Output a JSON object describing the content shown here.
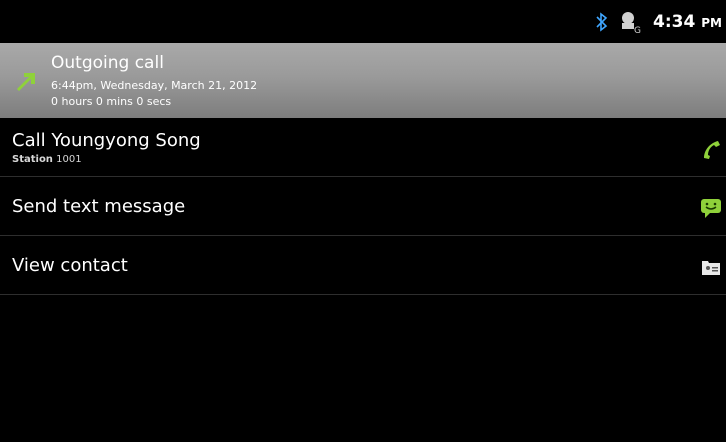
{
  "status_bar": {
    "time": "4:34",
    "ampm": "PM",
    "icons": [
      "bluetooth-icon",
      "network-g-icon"
    ]
  },
  "call_header": {
    "title": "Outgoing call",
    "datetime": "6:44pm, Wednesday, March 21, 2012",
    "duration": "0 hours 0 mins 0 secs",
    "icon": "outgoing-call-arrow-icon"
  },
  "actions": [
    {
      "label": "Call Youngyong Song",
      "sub_type": "Station",
      "sub_value": "1001",
      "icon": "phone-icon"
    },
    {
      "label": "Send text message",
      "icon": "text-message-icon"
    },
    {
      "label": "View contact",
      "icon": "contact-card-icon"
    }
  ],
  "colors": {
    "accent_green": "#8fd13a",
    "header_gray": "#9a9a9a",
    "background": "#000000"
  }
}
